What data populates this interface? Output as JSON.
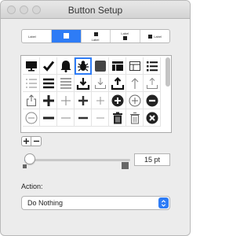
{
  "window": {
    "title": "Button Setup"
  },
  "styles": [
    "Label",
    "",
    "Label",
    "Label",
    "Label"
  ],
  "icons": [
    "monitor-icon",
    "checkmark-icon",
    "bell-icon",
    "bug-icon",
    "dark-square-icon",
    "table-icon",
    "table-outline-icon",
    "bullet-list-icon",
    "checklist-icon",
    "align-justify-icon",
    "align-lines-icon",
    "download-filled-icon",
    "download-outline-icon",
    "upload-filled-icon",
    "upload-arrow-icon",
    "upload-outline-icon",
    "share-outline-icon",
    "plus-bold-icon",
    "plus-light-icon",
    "plus-medium-icon",
    "plus-thin-icon",
    "plus-circle-filled-icon",
    "plus-circle-outline-icon",
    "minus-circle-filled-icon",
    "minus-circle-outline-icon",
    "minus-bold-icon",
    "minus-light-icon",
    "minus-medium-icon",
    "minus-thin-icon",
    "trash-filled-icon",
    "trash-outline-icon",
    "x-circle-filled-icon"
  ],
  "size": {
    "value": "15 pt",
    "slider_fraction": 0.05
  },
  "action": {
    "label": "Action:",
    "selected": "Do Nothing"
  },
  "colors": {
    "accent": "#2e7cf6"
  }
}
